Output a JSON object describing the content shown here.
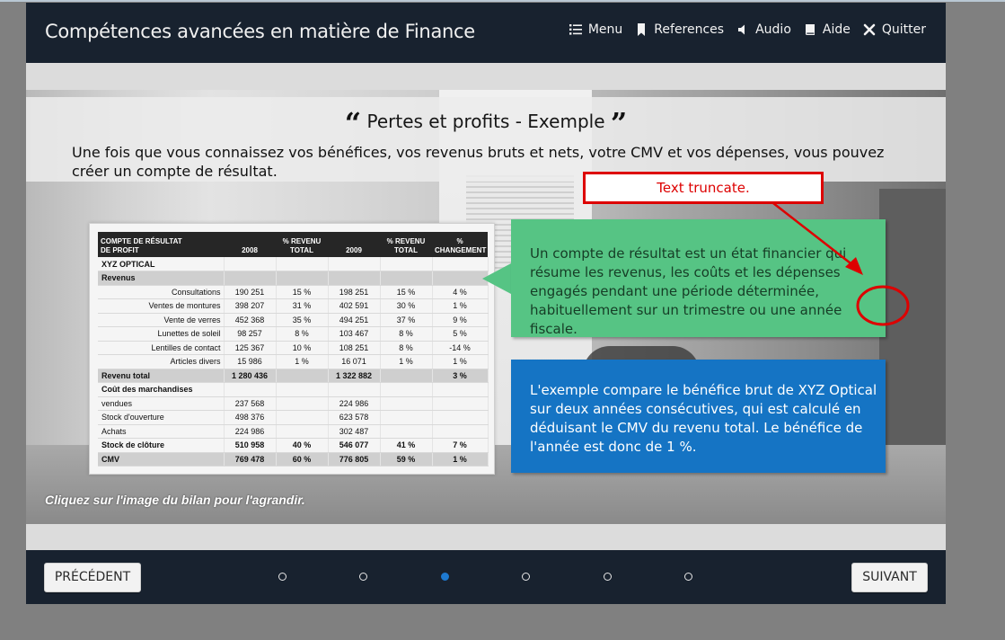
{
  "header": {
    "title": "Compétences avancées en matière de Finance",
    "nav": [
      {
        "label": "Menu",
        "icon": "list-icon"
      },
      {
        "label": "References",
        "icon": "bookmark-icon"
      },
      {
        "label": "Audio",
        "icon": "speaker-icon"
      },
      {
        "label": "Aide",
        "icon": "book-icon"
      },
      {
        "label": "Quitter",
        "icon": "close-icon"
      }
    ]
  },
  "slide": {
    "title": "Pertes et profits - Exemple",
    "quote_open": "“",
    "quote_close": "”",
    "intro": "Une fois que vous connaissez vos bénéfices, vos revenus bruts et nets, votre CMV et vos dépenses, vous pouvez créer un compte de résultat.",
    "click_hint": "Cliquez sur l'image du bilan pour l'agrandir.",
    "green_text": "Un compte de résultat est un état financier qui\nrésume les revenus, les coûts et les dépenses\nengagés pendant une période déterminée,\nhabituellement sur un trimestre ou une année fiscale.",
    "blue_text": "L'exemple compare le bénéfice brut de XYZ Optical\nsur deux années consécutives, qui est calculé en\ndéduisant le CMV du revenu total. Le bénéfice de\nl'année est donc de 1 %.",
    "annotation": "Text truncate."
  },
  "table": {
    "headers": [
      "COMPTE DE RÉSULTAT\nDE PROFIT",
      "2008",
      "% REVENU\nTOTAL",
      "2009",
      "% REVENU\nTOTAL",
      "%\nCHANGEMENT"
    ],
    "rows": [
      {
        "cells": [
          "XYZ OPTICAL",
          "",
          "",
          "",
          "",
          ""
        ],
        "style": "section"
      },
      {
        "cells": [
          "Revenus",
          "",
          "",
          "",
          "",
          ""
        ],
        "style": "grey"
      },
      {
        "cells": [
          "Consultations",
          "190 251",
          "15 %",
          "198 251",
          "15 %",
          "4 %"
        ],
        "style": "indent"
      },
      {
        "cells": [
          "Ventes de montures",
          "398 207",
          "31 %",
          "402 591",
          "30 %",
          "1 %"
        ],
        "style": "indent"
      },
      {
        "cells": [
          "Vente de verres",
          "452 368",
          "35 %",
          "494 251",
          "37 %",
          "9 %"
        ],
        "style": "indent"
      },
      {
        "cells": [
          "Lunettes de soleil",
          "98 257",
          "8 %",
          "103 467",
          "8 %",
          "5 %"
        ],
        "style": "indent"
      },
      {
        "cells": [
          "Lentilles de contact",
          "125 367",
          "10 %",
          "108 251",
          "8 %",
          "-14 %"
        ],
        "style": "indent"
      },
      {
        "cells": [
          "Articles divers",
          "15 986",
          "1 %",
          "16 071",
          "1 %",
          "1 %"
        ],
        "style": "indent"
      },
      {
        "cells": [
          "Revenu total",
          "1 280 436",
          "",
          "1 322 882",
          "",
          "3 %"
        ],
        "style": "grey"
      },
      {
        "cells": [
          "Coût des marchandises",
          "",
          "",
          "",
          "",
          ""
        ],
        "style": "section"
      },
      {
        "cells": [
          "vendues",
          "237 568",
          "",
          "224 986",
          "",
          ""
        ],
        "style": "plain"
      },
      {
        "cells": [
          "Stock d'ouverture",
          "498 376",
          "",
          "623 578",
          "",
          ""
        ],
        "style": "plain"
      },
      {
        "cells": [
          "Achats",
          "224 986",
          "",
          "302 487",
          "",
          ""
        ],
        "style": "plain"
      },
      {
        "cells": [
          "Stock de clôture",
          "510 958",
          "40 %",
          "546 077",
          "41 %",
          "7 %"
        ],
        "style": "section"
      },
      {
        "cells": [
          "CMV",
          "769 478",
          "60 %",
          "776 805",
          "59 %",
          "1 %"
        ],
        "style": "grey"
      }
    ]
  },
  "footer": {
    "prev_label": "PRÉCÉDENT",
    "next_label": "SUIVANT",
    "dots_count": 6,
    "active_dot": 2
  },
  "colors": {
    "header_bg": "#18222f",
    "green_box": "#56c484",
    "blue_box": "#1574c4",
    "annotation": "#dd0000",
    "active_dot": "#1e7ad1"
  }
}
